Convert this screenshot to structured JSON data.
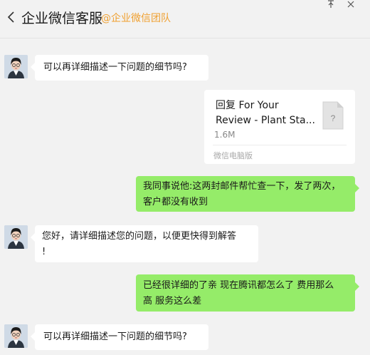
{
  "header": {
    "title": "企业微信客服",
    "org": "@企业微信团队"
  },
  "messages": [
    {
      "text": "可以再详细描述一下问题的细节吗?"
    },
    {
      "file": {
        "line1": "回复 For Your",
        "line2": "Review - Plant Sta...",
        "size": "1.6M",
        "source": "微信电脑版"
      }
    },
    {
      "text_line1": "我同事说他:这两封邮件帮忙查一下，发了两次，",
      "text_line2": "客户都没有收到"
    },
    {
      "text_line1": "您好，请详细描述您的问题，以便更快得到解答",
      "text_line2": "!"
    },
    {
      "text_line1": "已经很详细的了亲  现在腾讯都怎么了  费用那么",
      "text_line2": "高  服务这么差"
    },
    {
      "text": "可以再详细描述一下问题的细节吗?"
    }
  ]
}
